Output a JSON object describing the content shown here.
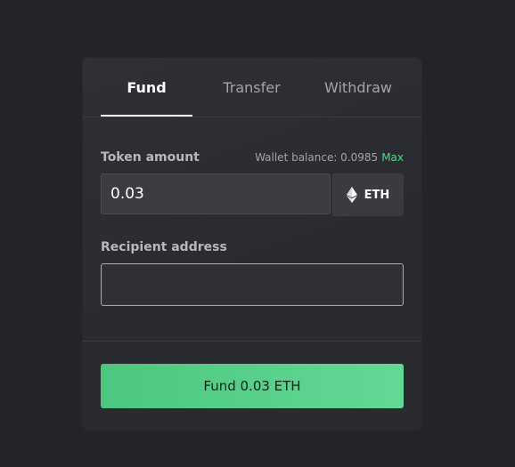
{
  "tabs": [
    {
      "label": "Fund"
    },
    {
      "label": "Transfer"
    },
    {
      "label": "Withdraw"
    }
  ],
  "form": {
    "token_amount_label": "Token amount",
    "wallet_balance_text": "Wallet balance: 0.0985",
    "max_label": "Max",
    "amount_value": "0.03",
    "token_symbol": "ETH",
    "recipient_label": "Recipient address",
    "recipient_value": ""
  },
  "submit": {
    "label": "Fund 0.03 ETH"
  },
  "colors": {
    "background": "#232427",
    "card": "#2b2c31",
    "accent_green": "#58d58a",
    "button_green": "#5bd28d"
  },
  "icons": {
    "token_icon": "ethereum-icon"
  }
}
